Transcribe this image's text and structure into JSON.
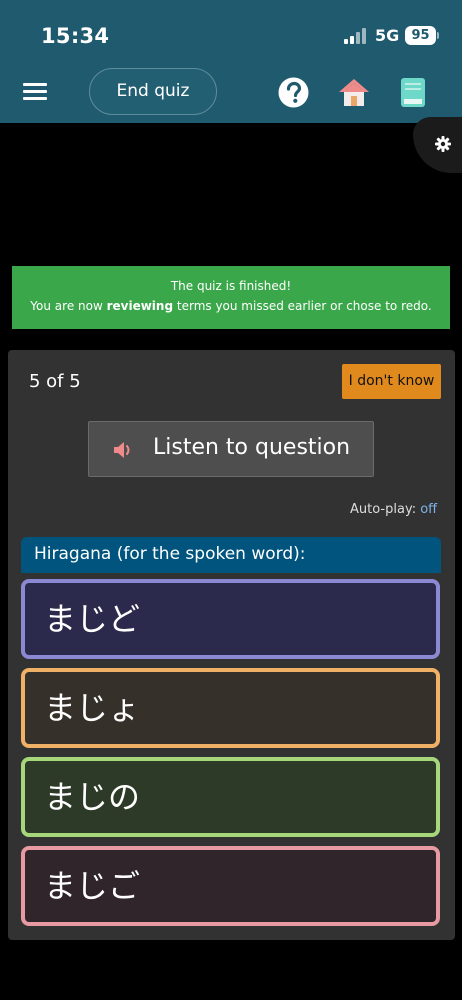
{
  "status_bar": {
    "time": "15:34",
    "network": "5G",
    "battery": "95"
  },
  "header": {
    "end_quiz_label": "End quiz",
    "icons": [
      "menu-icon",
      "help-icon",
      "home-icon",
      "book-icon"
    ],
    "colors": {
      "bar": "#205a6e",
      "help": "#ffffff",
      "home_roof": "#f08b8b",
      "book": "#6fd9c9"
    }
  },
  "banner": {
    "line1": "The quiz is finished!",
    "line2_prefix": "You are now ",
    "line2_bold": "reviewing",
    "line2_suffix": " terms you missed earlier or chose to redo.",
    "color": "#3aa84a"
  },
  "quiz": {
    "counter": "5 of 5",
    "idk_label": "I don't know",
    "listen_label": "Listen to question",
    "autoplay_label": "Auto-play:",
    "autoplay_state": "off",
    "question_header": "Hiragana (for the spoken word):",
    "choices": [
      {
        "text": "まじど",
        "border": "#8c89d4"
      },
      {
        "text": "まじょ",
        "border": "#f0b066"
      },
      {
        "text": "まじの",
        "border": "#a7d77b"
      },
      {
        "text": "まじご",
        "border": "#e79aa2"
      }
    ]
  }
}
